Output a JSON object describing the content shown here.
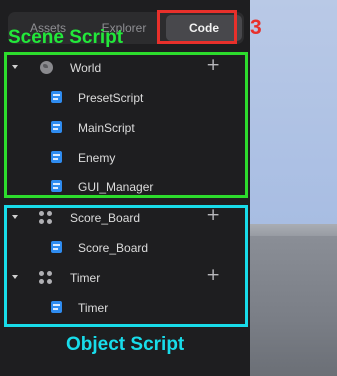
{
  "tabs": {
    "assets": "Assets",
    "explorer": "Explorer",
    "code": "Code",
    "active": "Code"
  },
  "annotations": {
    "step_number": "3",
    "scene_script_label": "Scene Script",
    "object_script_label": "Object Script",
    "colors": {
      "step_highlight": "#e8302b",
      "scene_script": "#2ddc2d",
      "object_script": "#18dcea"
    }
  },
  "tree": {
    "world": {
      "label": "World",
      "icon": "globe-icon",
      "expanded": true,
      "scripts": [
        "PresetScript",
        "MainScript",
        "Enemy",
        "GUI_Manager"
      ]
    },
    "score_board": {
      "label": "Score_Board",
      "icon": "object-dots-icon",
      "expanded": true,
      "scripts": [
        "Score_Board"
      ]
    },
    "timer": {
      "label": "Timer",
      "icon": "object-dots-icon",
      "expanded": true,
      "scripts": [
        "Timer"
      ]
    },
    "add_icon": "plus-icon",
    "script_icon": "script-file-icon"
  },
  "theme": {
    "panel_bg": "#1e1e20",
    "script_icon_color": "#2f8cf0"
  }
}
